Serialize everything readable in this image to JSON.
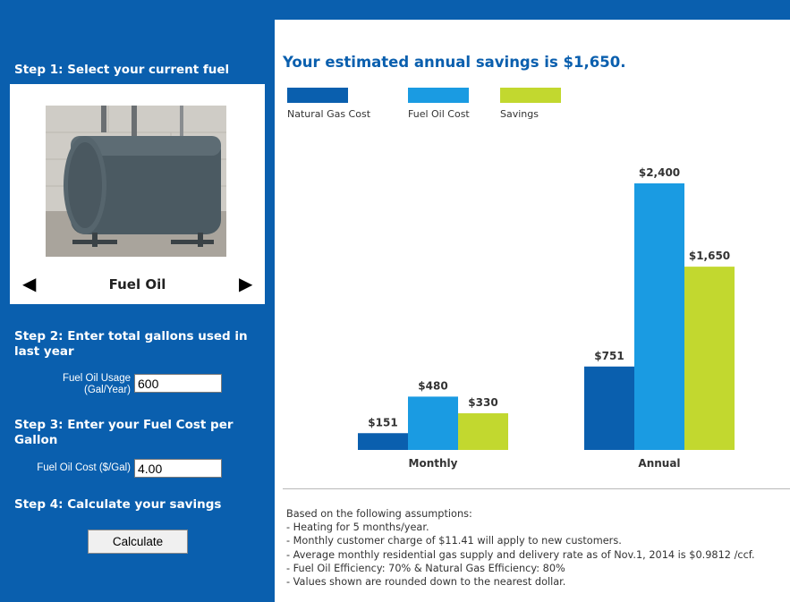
{
  "sidebar": {
    "step1_title": "Step 1: Select your current fuel",
    "fuel_selected": "Fuel Oil",
    "step2_title": "Step 2: Enter total gallons used in last year",
    "usage_label_line1": "Fuel Oil Usage",
    "usage_label_line2": "(Gal/Year)",
    "usage_value": "600",
    "step3_title": "Step 3: Enter your Fuel Cost per Gallon",
    "cost_label": "Fuel Oil Cost ($/Gal)",
    "cost_value": "4.00",
    "step4_title": "Step 4: Calculate your savings",
    "calculate_label": "Calculate"
  },
  "results": {
    "headline": "Your estimated annual savings is $1,650."
  },
  "colors": {
    "sidebar_blue": "#0a5fae",
    "natural_gas": "#0a5fae",
    "fuel_oil": "#1a9be2",
    "savings": "#c2d82f"
  },
  "chart_data": {
    "type": "bar",
    "categories": [
      "Monthly",
      "Annual"
    ],
    "series": [
      {
        "name": "Natural Gas Cost",
        "values": [
          151,
          751
        ],
        "labels": [
          "$151",
          "$751"
        ],
        "color": "#0a5fae"
      },
      {
        "name": "Fuel Oil Cost",
        "values": [
          480,
          2400
        ],
        "labels": [
          "$480",
          "$2,400"
        ],
        "color": "#1a9be2"
      },
      {
        "name": "Savings",
        "values": [
          330,
          1650
        ],
        "labels": [
          "$330",
          "$1,650"
        ],
        "color": "#c2d82f"
      }
    ],
    "title": "",
    "xlabel": "",
    "ylabel": "",
    "grid": false,
    "legend": "top-left"
  },
  "assumptions": {
    "intro": "Based on the following assumptions:",
    "items": [
      "- Heating for 5 months/year.",
      "- Monthly customer charge of $11.41 will apply to new customers.",
      "- Average monthly residential gas supply and delivery rate as of Nov.1, 2014 is $0.9812 /ccf.",
      "- Fuel Oil Efficiency: 70% & Natural Gas Efficiency: 80%",
      "- Values shown are rounded down to the nearest dollar."
    ]
  }
}
